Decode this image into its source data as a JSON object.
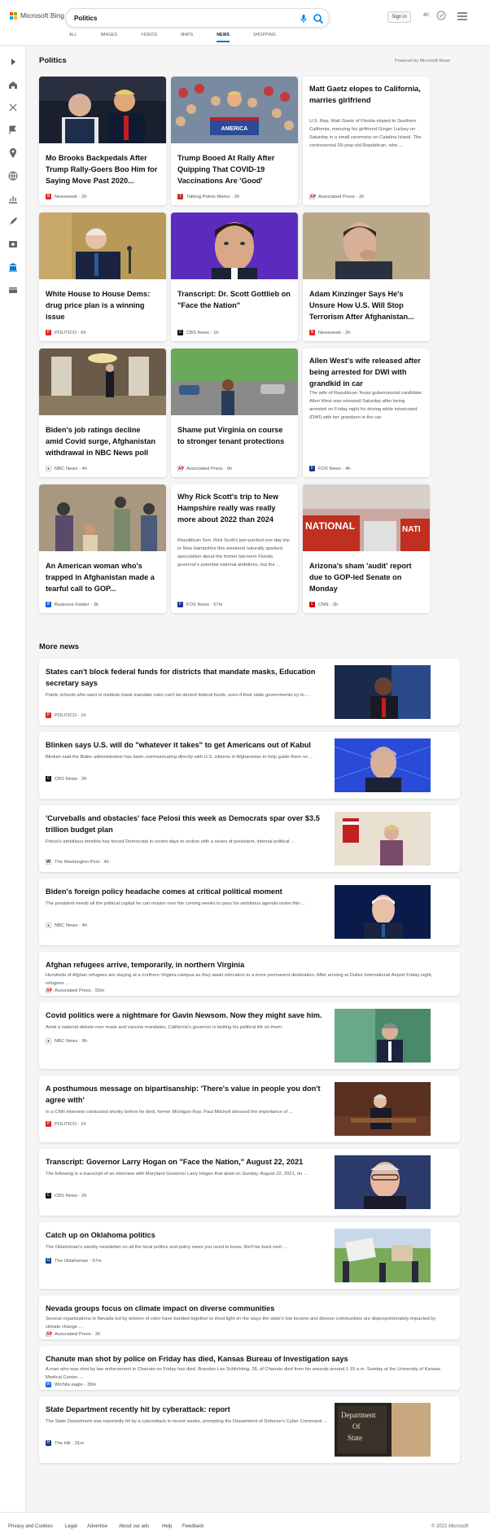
{
  "header": {
    "brand": "Microsoft Bing",
    "search_value": "Politics",
    "signin_label": "Sign in",
    "points": "40",
    "tabs": [
      "ALL",
      "IMAGES",
      "VIDEOS",
      "MAPS",
      "NEWS",
      "SHOPPING"
    ],
    "active_tab": "NEWS"
  },
  "politics": {
    "title": "Politics",
    "powered": "Powered by Microsoft News",
    "cards": [
      {
        "title": "Mo Brooks Backpedals After Trump Rally-Goers Boo Him for Saying Move Past 2020...",
        "source": "Newsweek",
        "age": "2h",
        "has_image": true
      },
      {
        "title": "Trump Booed At Rally After Quipping That COVID-19 Vaccinations Are 'Good'",
        "source": "Talking Points Memo",
        "age": "2h",
        "has_image": true
      },
      {
        "title": "Matt Gaetz elopes to California, marries girlfriend",
        "snippet": "U.S. Rep. Matt Gaetz of Florida eloped to Southern California, marrying his girlfriend Ginger Luckey on Saturday in a small ceremony on Catalina Island. The controversial 39-year-old Republican, who ...",
        "source": "Associated Press",
        "age": "2h",
        "has_image": false
      },
      {
        "title": "White House to House Dems: drug price plan is a winning issue",
        "source": "POLITICO",
        "age": "6h",
        "has_image": true
      },
      {
        "title": "Transcript: Dr. Scott Gottlieb on \"Face the Nation\"",
        "source": "CBS News",
        "age": "1h",
        "has_image": true
      },
      {
        "title": "Adam Kinzinger Says He's Unsure How U.S. Will Stop Terrorism After Afghanistan...",
        "source": "Newsweek",
        "age": "2h",
        "has_image": true
      },
      {
        "title": "Biden's job ratings decline amid Covid surge, Afghanistan withdrawal in NBC News poll",
        "source": "NBC News",
        "age": "4h",
        "has_image": true
      },
      {
        "title": "Shame put Virginia on course to stronger tenant protections",
        "source": "Associated Press",
        "age": "5h",
        "has_image": true
      },
      {
        "title": "Allen West's wife released after being arrested for DWI with grandkid in car",
        "snippet": "The wife of Republican Texas gubernatorial candidate Allen West was released Saturday after being arrested on Friday night for driving while intoxicated (DWI) with her grandson in the car.",
        "source": "FOX News",
        "age": "4h",
        "has_image": false
      },
      {
        "title": "An American woman who's trapped in Afghanistan made a tearful call to GOP...",
        "source": "Business Insider",
        "age": "3h",
        "has_image": true
      },
      {
        "title": "Why Rick Scott's trip to New Hampshire really was really more about 2022 than 2024",
        "snippet": "Republican Sen. Rick Scott's jam-packed one day trip to New Hampshire this weekend naturally sparked speculation about the former two-term Florida governor's potential national ambitions, but the ...",
        "source": "FOX News",
        "age": "57m",
        "has_image": false
      },
      {
        "title": "Arizona's sham 'audit' report due to GOP-led Senate on Monday",
        "source": "CNN",
        "age": "2h",
        "has_image": true
      }
    ]
  },
  "more_news": {
    "title": "More news",
    "items": [
      {
        "title": "States can't block federal funds for districts that mandate masks, Education secretary says",
        "snippet": "Public schools who want to institute mask mandate rules can't be denied federal funds, even if their state governments try to ...",
        "source": "POLITICO",
        "age": "1h"
      },
      {
        "title": "Blinken says U.S. will do \"whatever it takes\" to get Americans out of Kabul",
        "snippet": "Blinken said the Biden administration has been communicating directly with U.S. citizens in Afghanistan to help guide them on ...",
        "source": "CBS News",
        "age": "2h"
      },
      {
        "title": "'Curveballs and obstacles' face Pelosi this week as Democrats spar over $3.5 trillion budget plan",
        "snippet": "Pelosi's ambitious timeline has forced Democrats in recent days to reckon with a series of persistent, internal political ...",
        "source": "The Washington Post",
        "age": "4h"
      },
      {
        "title": "Biden's foreign policy headache comes at critical political moment",
        "snippet": "The president needs all the political capital he can muster over the coming weeks to pass his ambitious agenda under thin ...",
        "source": "NBC News",
        "age": "4h"
      },
      {
        "title": "Afghan refugees arrive, temporarily, in northern Virginia",
        "snippet": "Hundreds of Afghan refugees are staying at a northern Virginia campus as they await relocation to a more permanent destination. After arriving at Dulles International Airport Friday night, refugees ...",
        "source": "Associated Press",
        "age": "52m"
      },
      {
        "title": "Covid politics were a nightmare for Gavin Newsom. Now they might save him.",
        "snippet": "Amid a national debate over mask and vaccine mandates, California's governor is betting his political life on them.",
        "source": "NBC News",
        "age": "9h"
      },
      {
        "title": "A posthumous message on bipartisanship: 'There's value in people you don't agree with'",
        "snippet": "In a CNN interview conducted shortly before he died, former Michigan Rep. Paul Mitchell stressed the importance of ...",
        "source": "POLITICO",
        "age": "1h"
      },
      {
        "title": "Transcript: Governor Larry Hogan on \"Face the Nation,\" August 22, 2021",
        "snippet": "The following is a transcript of an interview with Maryland Governor Larry Hogan that aired on Sunday, August 22, 2021, on ...",
        "source": "CBS News",
        "age": "2h"
      },
      {
        "title": "Catch up on Oklahoma politics",
        "snippet": "The Oklahoman's weekly newsletter on all the local politics and policy news you need to know.  We'll be back next ...",
        "source": "The Oklahoman",
        "age": "57m"
      },
      {
        "title": "Nevada groups focus on climate impact on diverse communities",
        "snippet": "Several organizations in Nevada led by women of color have banded together to shed light on the ways the state's low income and diverse communities are disproportionately impacted by climate change ...",
        "source": "Associated Press",
        "age": "2h"
      },
      {
        "title": "Chanute man shot by police on Friday has died, Kansas Bureau of Investigation says",
        "snippet": "A man who was shot by law enforcement in Chanute on Friday has died. Brandon Lee Schlichting, 28, of Chanute died from his wounds around 1:15 a.m. Sunday at the University of Kansas Medical Center, ...",
        "source": "Wichita eagle",
        "age": "35m"
      },
      {
        "title": "State Department recently hit by cyberattack: report",
        "snippet": "The State Department was reportedly hit by a cyberattack in recent weeks, prompting the Department of Defense's Cyber Command ...",
        "source": "The Hill",
        "age": "31m"
      }
    ]
  },
  "image_text": {
    "sign_words": [
      "Department",
      "Of",
      "State"
    ]
  },
  "footer": {
    "links": [
      "Privacy and Cookies",
      "Legal",
      "Advertise",
      "About our ads",
      "Help",
      "Feedback"
    ],
    "copyright": "© 2021 Microsoft"
  }
}
